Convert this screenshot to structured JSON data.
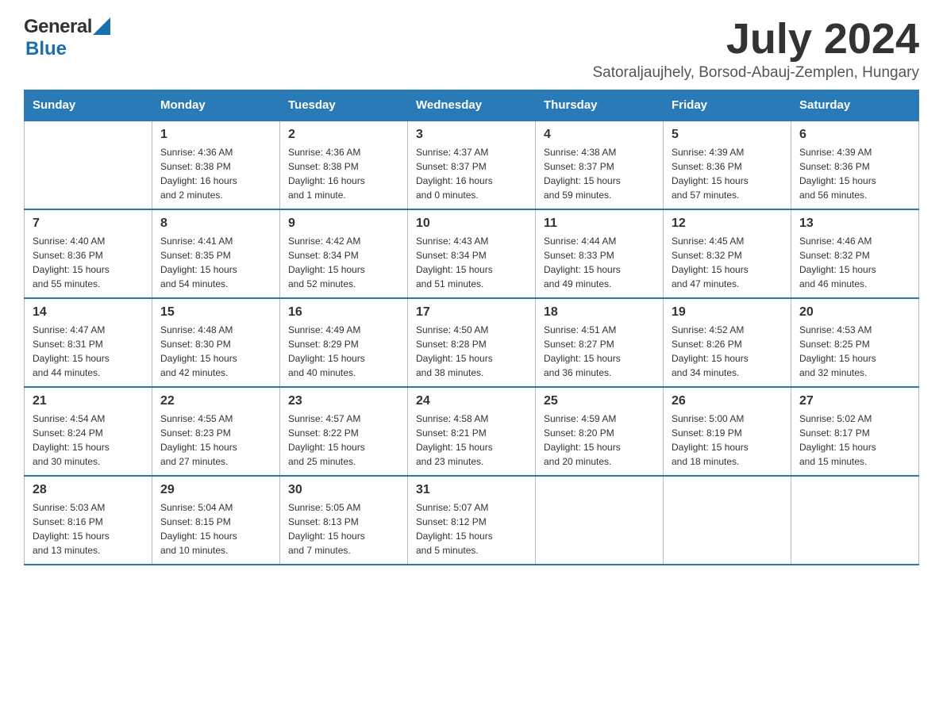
{
  "header": {
    "logo_general": "General",
    "logo_blue": "Blue",
    "month_title": "July 2024",
    "location": "Satoraljaujhely, Borsod-Abauj-Zemplen, Hungary"
  },
  "days_of_week": [
    "Sunday",
    "Monday",
    "Tuesday",
    "Wednesday",
    "Thursday",
    "Friday",
    "Saturday"
  ],
  "weeks": [
    [
      {
        "day": "",
        "info": ""
      },
      {
        "day": "1",
        "info": "Sunrise: 4:36 AM\nSunset: 8:38 PM\nDaylight: 16 hours\nand 2 minutes."
      },
      {
        "day": "2",
        "info": "Sunrise: 4:36 AM\nSunset: 8:38 PM\nDaylight: 16 hours\nand 1 minute."
      },
      {
        "day": "3",
        "info": "Sunrise: 4:37 AM\nSunset: 8:37 PM\nDaylight: 16 hours\nand 0 minutes."
      },
      {
        "day": "4",
        "info": "Sunrise: 4:38 AM\nSunset: 8:37 PM\nDaylight: 15 hours\nand 59 minutes."
      },
      {
        "day": "5",
        "info": "Sunrise: 4:39 AM\nSunset: 8:36 PM\nDaylight: 15 hours\nand 57 minutes."
      },
      {
        "day": "6",
        "info": "Sunrise: 4:39 AM\nSunset: 8:36 PM\nDaylight: 15 hours\nand 56 minutes."
      }
    ],
    [
      {
        "day": "7",
        "info": "Sunrise: 4:40 AM\nSunset: 8:36 PM\nDaylight: 15 hours\nand 55 minutes."
      },
      {
        "day": "8",
        "info": "Sunrise: 4:41 AM\nSunset: 8:35 PM\nDaylight: 15 hours\nand 54 minutes."
      },
      {
        "day": "9",
        "info": "Sunrise: 4:42 AM\nSunset: 8:34 PM\nDaylight: 15 hours\nand 52 minutes."
      },
      {
        "day": "10",
        "info": "Sunrise: 4:43 AM\nSunset: 8:34 PM\nDaylight: 15 hours\nand 51 minutes."
      },
      {
        "day": "11",
        "info": "Sunrise: 4:44 AM\nSunset: 8:33 PM\nDaylight: 15 hours\nand 49 minutes."
      },
      {
        "day": "12",
        "info": "Sunrise: 4:45 AM\nSunset: 8:32 PM\nDaylight: 15 hours\nand 47 minutes."
      },
      {
        "day": "13",
        "info": "Sunrise: 4:46 AM\nSunset: 8:32 PM\nDaylight: 15 hours\nand 46 minutes."
      }
    ],
    [
      {
        "day": "14",
        "info": "Sunrise: 4:47 AM\nSunset: 8:31 PM\nDaylight: 15 hours\nand 44 minutes."
      },
      {
        "day": "15",
        "info": "Sunrise: 4:48 AM\nSunset: 8:30 PM\nDaylight: 15 hours\nand 42 minutes."
      },
      {
        "day": "16",
        "info": "Sunrise: 4:49 AM\nSunset: 8:29 PM\nDaylight: 15 hours\nand 40 minutes."
      },
      {
        "day": "17",
        "info": "Sunrise: 4:50 AM\nSunset: 8:28 PM\nDaylight: 15 hours\nand 38 minutes."
      },
      {
        "day": "18",
        "info": "Sunrise: 4:51 AM\nSunset: 8:27 PM\nDaylight: 15 hours\nand 36 minutes."
      },
      {
        "day": "19",
        "info": "Sunrise: 4:52 AM\nSunset: 8:26 PM\nDaylight: 15 hours\nand 34 minutes."
      },
      {
        "day": "20",
        "info": "Sunrise: 4:53 AM\nSunset: 8:25 PM\nDaylight: 15 hours\nand 32 minutes."
      }
    ],
    [
      {
        "day": "21",
        "info": "Sunrise: 4:54 AM\nSunset: 8:24 PM\nDaylight: 15 hours\nand 30 minutes."
      },
      {
        "day": "22",
        "info": "Sunrise: 4:55 AM\nSunset: 8:23 PM\nDaylight: 15 hours\nand 27 minutes."
      },
      {
        "day": "23",
        "info": "Sunrise: 4:57 AM\nSunset: 8:22 PM\nDaylight: 15 hours\nand 25 minutes."
      },
      {
        "day": "24",
        "info": "Sunrise: 4:58 AM\nSunset: 8:21 PM\nDaylight: 15 hours\nand 23 minutes."
      },
      {
        "day": "25",
        "info": "Sunrise: 4:59 AM\nSunset: 8:20 PM\nDaylight: 15 hours\nand 20 minutes."
      },
      {
        "day": "26",
        "info": "Sunrise: 5:00 AM\nSunset: 8:19 PM\nDaylight: 15 hours\nand 18 minutes."
      },
      {
        "day": "27",
        "info": "Sunrise: 5:02 AM\nSunset: 8:17 PM\nDaylight: 15 hours\nand 15 minutes."
      }
    ],
    [
      {
        "day": "28",
        "info": "Sunrise: 5:03 AM\nSunset: 8:16 PM\nDaylight: 15 hours\nand 13 minutes."
      },
      {
        "day": "29",
        "info": "Sunrise: 5:04 AM\nSunset: 8:15 PM\nDaylight: 15 hours\nand 10 minutes."
      },
      {
        "day": "30",
        "info": "Sunrise: 5:05 AM\nSunset: 8:13 PM\nDaylight: 15 hours\nand 7 minutes."
      },
      {
        "day": "31",
        "info": "Sunrise: 5:07 AM\nSunset: 8:12 PM\nDaylight: 15 hours\nand 5 minutes."
      },
      {
        "day": "",
        "info": ""
      },
      {
        "day": "",
        "info": ""
      },
      {
        "day": "",
        "info": ""
      }
    ]
  ]
}
